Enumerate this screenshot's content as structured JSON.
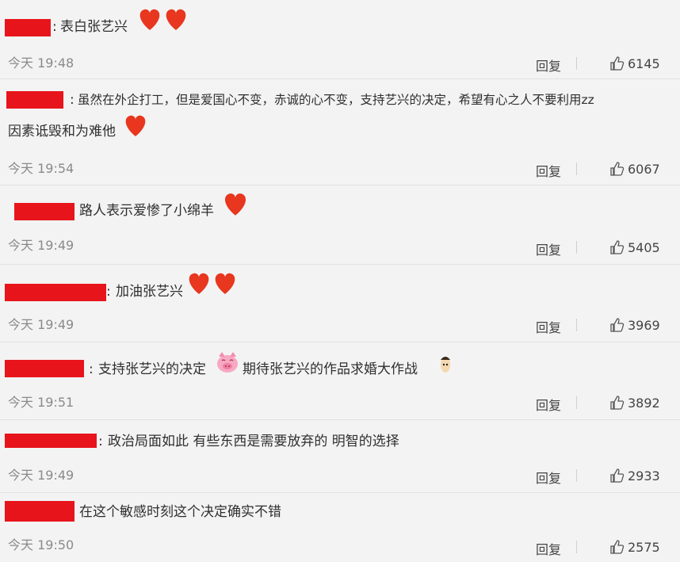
{
  "reply_label": "回复",
  "comments": [
    {
      "prefix": ":",
      "text": "表白张艺兴",
      "time": "今天 19:48",
      "likes": "6145"
    },
    {
      "prefix": ":",
      "text": "虽然在外企打工，但是爱国心不变，赤诚的心不变，支持艺兴的决定，希望有心之人不要利用zz",
      "text2": "因素诋毁和为难他",
      "time": "今天 19:54",
      "likes": "6067"
    },
    {
      "prefix": "",
      "text": "路人表示爱惨了小绵羊",
      "time": "今天 19:49",
      "likes": "5405"
    },
    {
      "prefix": ":",
      "text": "加油张艺兴",
      "time": "今天 19:49",
      "likes": "3969"
    },
    {
      "prefix": ":",
      "text": "支持张艺兴的决定",
      "text_b": "期待张艺兴的作品求婚大作战",
      "time": "今天 19:51",
      "likes": "3892"
    },
    {
      "prefix": ":",
      "text": "政治局面如此 有些东西是需要放弃的 明智的选择",
      "time": "今天 19:49",
      "likes": "2933"
    },
    {
      "prefix": "",
      "text": "在这个敏感时刻这个决定确实不错",
      "time": "今天 19:50",
      "likes": "2575"
    }
  ],
  "colors": {
    "redaction": "#e8141b",
    "heart": "#e8361f",
    "background": "#f3f3f3"
  },
  "icons": [
    "thumbs-up-icon",
    "heart-icon",
    "pig-face-icon",
    "cartoon-face-icon"
  ]
}
